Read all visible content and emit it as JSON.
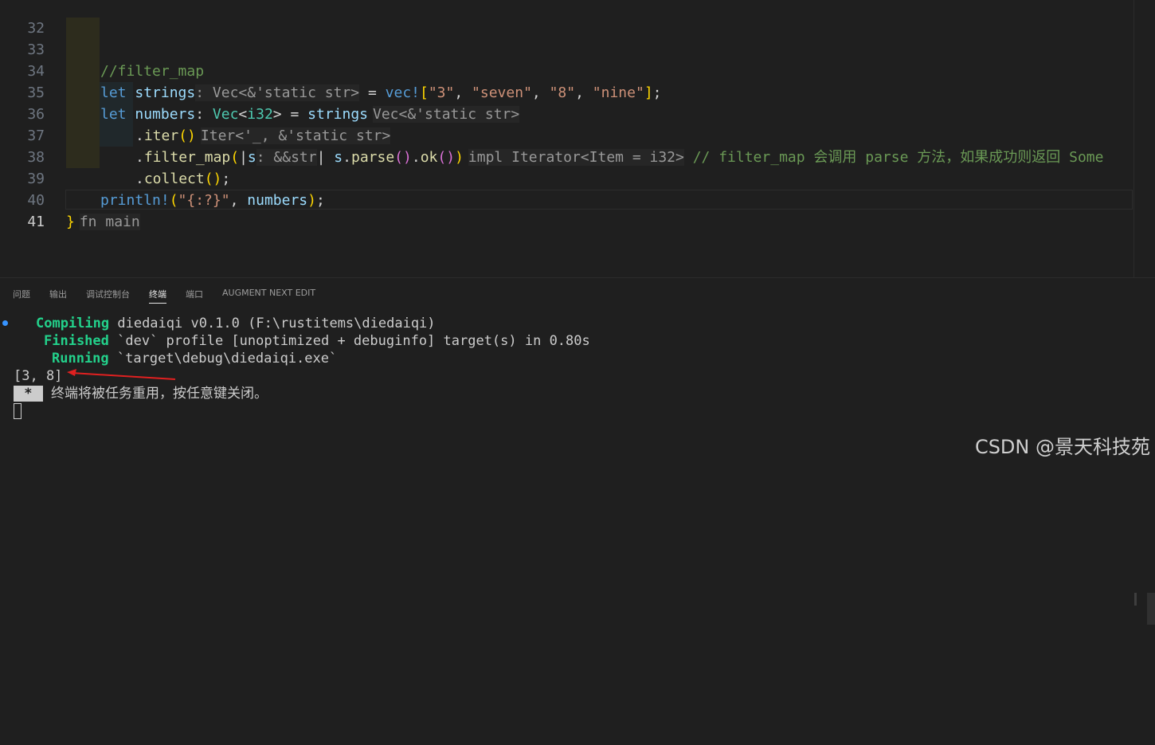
{
  "editor": {
    "lines": [
      {
        "num": "32",
        "active": false
      },
      {
        "num": "33",
        "active": false
      },
      {
        "num": "34",
        "active": false
      },
      {
        "num": "35",
        "active": false
      },
      {
        "num": "36",
        "active": false
      },
      {
        "num": "37",
        "active": false
      },
      {
        "num": "38",
        "active": false
      },
      {
        "num": "39",
        "active": false
      },
      {
        "num": "40",
        "active": false
      },
      {
        "num": "41",
        "active": true
      }
    ],
    "l33": {
      "comment": "//filter_map"
    },
    "l34": {
      "kw": "let",
      "var": "strings",
      "hint": ": Vec<&'static str>",
      "eq": " = ",
      "mac": "vec!",
      "ob": "[",
      "s1": "\"3\"",
      "c1": ", ",
      "s2": "\"seven\"",
      "c2": ", ",
      "s3": "\"8\"",
      "c3": ", ",
      "s4": "\"nine\"",
      "cb": "]",
      "semi": ";"
    },
    "l35": {
      "kw": "let",
      "var": "numbers",
      "colon": ": ",
      "ty": "Vec",
      "lt": "<",
      "ty2": "i32",
      "gt": ">",
      "eq": " = ",
      "var2": "strings",
      "hint": "Vec<&'static str>"
    },
    "l36": {
      "dot": ".",
      "fn": "iter",
      "paren": "()",
      "hint": "Iter<'_, &'static str>"
    },
    "l37": {
      "dot": ".",
      "fn": "filter_map",
      "op": "(",
      "pipe1": "|",
      "var": "s",
      "hint": ": &&str",
      "pipe2": "|",
      "sp": " ",
      "var2": "s",
      "dot2": ".",
      "fn2": "parse",
      "p1": "()",
      "dot3": ".",
      "fn3": "ok",
      "p2": "()",
      "cp": ")",
      "hint2": "impl Iterator<Item = i32>",
      "comment": " // filter_map 会调用 parse 方法，如果成功则返回 Some"
    },
    "l38": {
      "dot": ".",
      "fn": "collect",
      "paren": "()",
      "semi": ";"
    },
    "l39": {
      "mac": "println!",
      "op": "(",
      "str": "\"{:?}\"",
      "comma": ", ",
      "var": "numbers",
      "cp": ")",
      "semi": ";"
    },
    "l40": {
      "brace": "}",
      "hint": "fn main"
    }
  },
  "panel": {
    "tabs": [
      {
        "label": "问题"
      },
      {
        "label": "输出"
      },
      {
        "label": "调试控制台"
      },
      {
        "label": "终端",
        "active": true
      },
      {
        "label": "端口"
      },
      {
        "label": "AUGMENT NEXT EDIT"
      }
    ],
    "terminal": {
      "l1_label": "Compiling",
      "l1_text": " diedaiqi v0.1.0 (F:\\rustitems\\diedaiqi)",
      "l2_label": "Finished",
      "l2_text": " `dev` profile [unoptimized + debuginfo] target(s) in 0.80s",
      "l3_label": "Running",
      "l3_text": " `target\\debug\\diedaiqi.exe`",
      "l4_text": "[3, 8]",
      "l5_star": " * ",
      "l5_text": " 终端将被任务重用，按任意键关闭。"
    }
  },
  "watermark": "CSDN @景天科技苑",
  "colors": {
    "bg": "#1f1f1f",
    "green": "#23d18b",
    "arrow": "#e02020"
  }
}
